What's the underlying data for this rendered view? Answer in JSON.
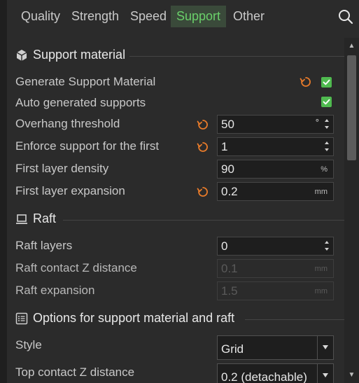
{
  "tabs": [
    {
      "label": "Quality",
      "active": false
    },
    {
      "label": "Strength",
      "active": false
    },
    {
      "label": "Speed",
      "active": false
    },
    {
      "label": "Support",
      "active": true
    },
    {
      "label": "Other",
      "active": false
    }
  ],
  "accent_color": "#6ad06a",
  "reset_color": "#e87b2a",
  "sections": {
    "support_material": {
      "title": "Support material",
      "icon": "cube-icon",
      "rows": {
        "generate": {
          "label": "Generate Support Material",
          "checked": true
        },
        "auto": {
          "label": "Auto generated supports",
          "checked": true
        },
        "overhang": {
          "label": "Overhang threshold",
          "value": "50",
          "unit": "°"
        },
        "enforce": {
          "label": "Enforce support for the first",
          "value": "1"
        },
        "density": {
          "label": "First layer density",
          "value": "90",
          "unit": "%"
        },
        "expansion": {
          "label": "First layer expansion",
          "value": "0.2",
          "unit": "mm"
        }
      }
    },
    "raft": {
      "title": "Raft",
      "icon": "raft-icon",
      "rows": {
        "layers": {
          "label": "Raft layers",
          "value": "0"
        },
        "contact_z": {
          "label": "Raft contact Z distance",
          "value": "0.1",
          "unit": "mm"
        },
        "expansion": {
          "label": "Raft expansion",
          "value": "1.5",
          "unit": "mm"
        }
      }
    },
    "options": {
      "title": "Options for support material and raft",
      "icon": "list-icon",
      "rows": {
        "style": {
          "label": "Style",
          "value": "Grid"
        },
        "top_contact": {
          "label": "Top contact Z distance",
          "value": "0.2 (detachable)"
        }
      }
    }
  }
}
